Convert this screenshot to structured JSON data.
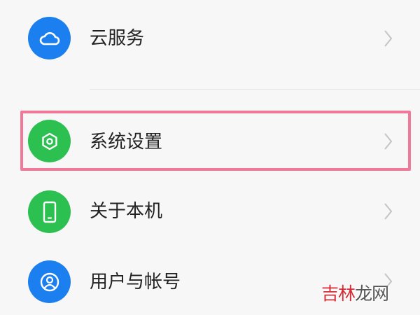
{
  "settings_list": {
    "items": [
      {
        "id": "cloud",
        "label": "云服务",
        "icon": "cloud-icon",
        "icon_color": "#1c7ff0"
      },
      {
        "id": "system",
        "label": "系统设置",
        "icon": "hexagon-gear-icon",
        "icon_color": "#2bc04f",
        "highlighted": true
      },
      {
        "id": "about",
        "label": "关于本机",
        "icon": "phone-icon",
        "icon_color": "#2bc04f"
      },
      {
        "id": "account",
        "label": "用户与帐号",
        "icon": "user-icon",
        "icon_color": "#1c7ff0"
      }
    ]
  },
  "highlight_color": "#f07898",
  "watermark": {
    "red": "吉林",
    "dark": "龙网"
  }
}
